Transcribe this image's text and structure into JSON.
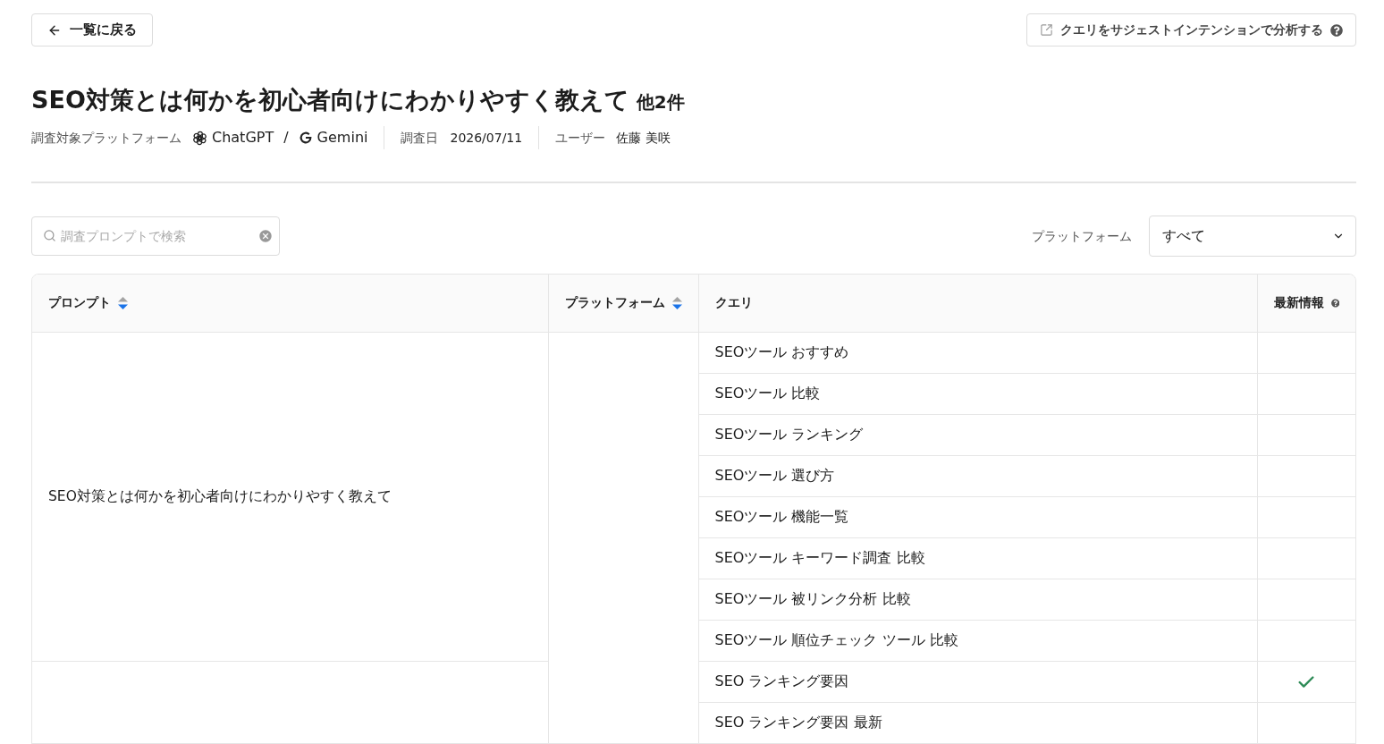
{
  "back_button": {
    "label": "一覧に戻る"
  },
  "analyze_button": {
    "label": "クエリをサジェストインテンションで分析する"
  },
  "title": {
    "text": "SEO対策とは何かを初心者向けにわかりやすく教えて",
    "count": "他2件"
  },
  "meta": {
    "platforms_label": "調査対象プラットフォーム",
    "platforms": [
      {
        "kind": "chatgpt",
        "name": "ChatGPT"
      },
      {
        "kind": "gemini",
        "name": "Gemini"
      }
    ],
    "platform_separator": "/",
    "date_label": "調査日",
    "date": "2026/07/11",
    "user_label": "ユーザー",
    "user": "佐藤 美咲"
  },
  "search": {
    "placeholder": "調査プロンプトで検索"
  },
  "platform_filter": {
    "label": "プラットフォーム",
    "value": "すべて"
  },
  "table": {
    "columns": [
      {
        "label": "プロンプト",
        "sortable": true,
        "sorted_descending": true
      },
      {
        "label": "プラットフォーム",
        "sortable": true,
        "sorted_descending": true
      },
      {
        "label": "クエリ"
      },
      {
        "label": "最新情報",
        "help": true
      }
    ],
    "groups": [
      {
        "prompt": "SEO対策とは何かを初心者向けにわかりやすく教えて",
        "queries": [
          {
            "text": "SEOツール おすすめ",
            "latest": false
          },
          {
            "text": "SEOツール 比較",
            "latest": false
          },
          {
            "text": "SEOツール ランキング",
            "latest": false
          },
          {
            "text": "SEOツール 選び方",
            "latest": false
          },
          {
            "text": "SEOツール 機能一覧",
            "latest": false
          },
          {
            "text": "SEOツール キーワード調査 比較",
            "latest": false
          },
          {
            "text": "SEOツール 被リンク分析 比較",
            "latest": false
          },
          {
            "text": "SEOツール 順位チェック ツール 比較",
            "latest": false
          }
        ]
      },
      {
        "queries": [
          {
            "text": "SEO ランキング要因",
            "latest": true
          },
          {
            "text": "SEO ランキング要因 最新",
            "latest": false
          }
        ]
      }
    ]
  }
}
